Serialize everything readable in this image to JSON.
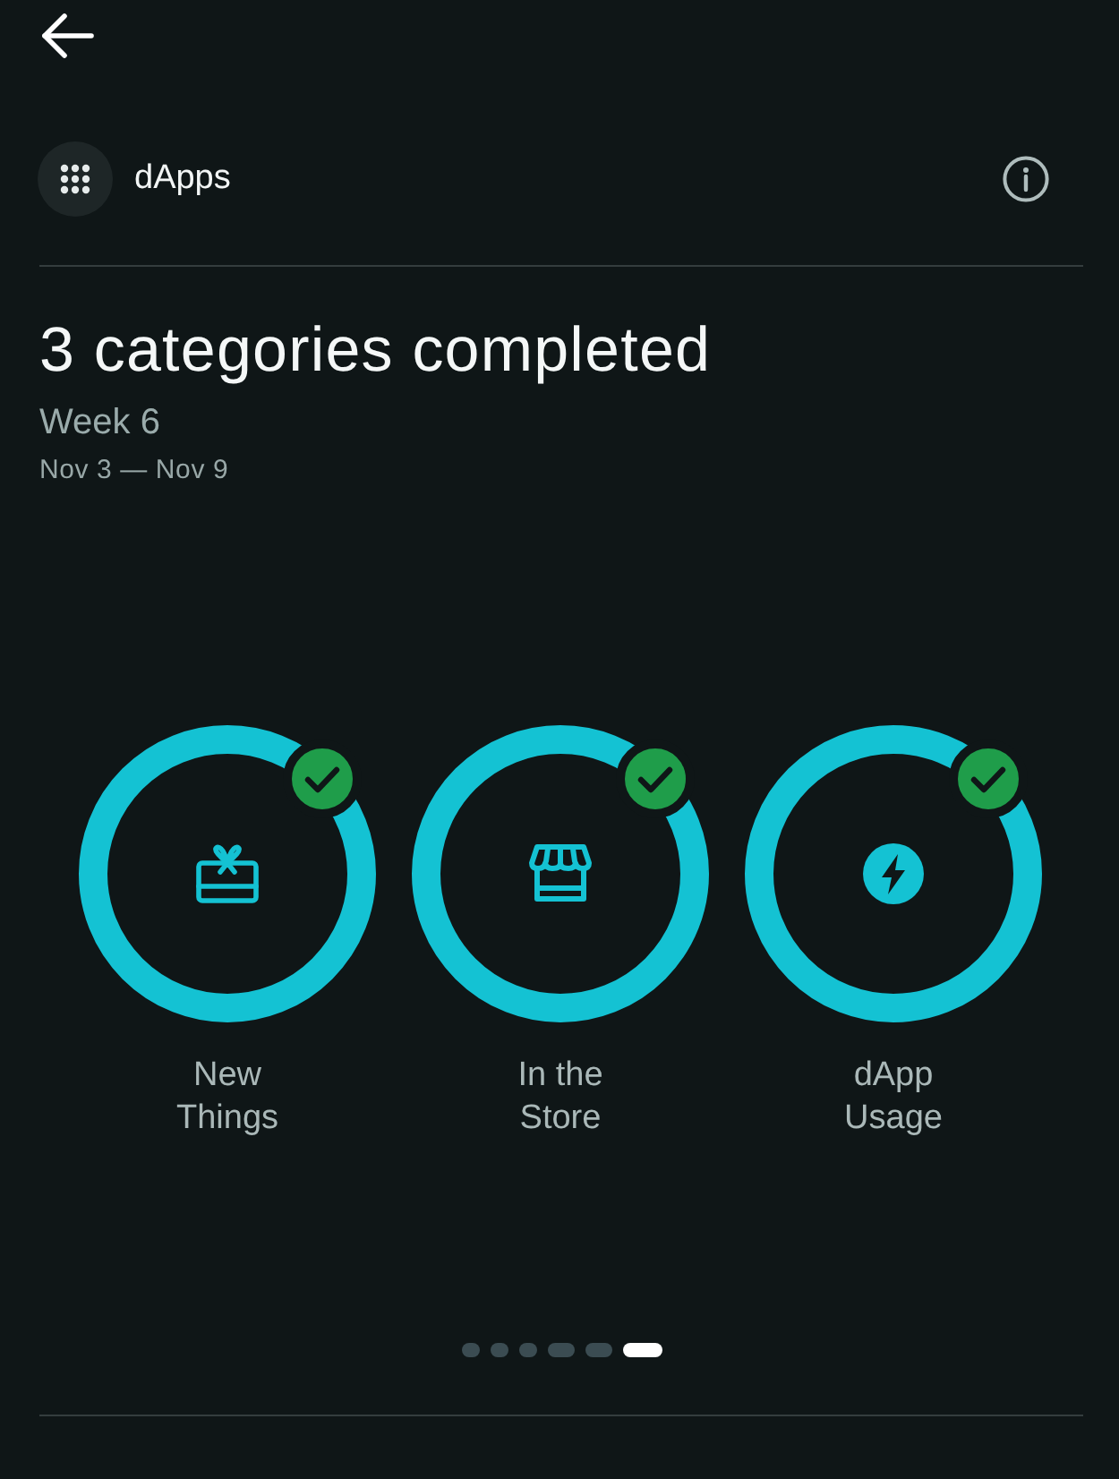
{
  "section": {
    "title": "dApps"
  },
  "summary": {
    "title": "3 categories completed",
    "week": "Week 6",
    "dates": "Nov 3 — Nov 9"
  },
  "categories": [
    {
      "kind": "gift",
      "label": "New Things",
      "completed": true
    },
    {
      "kind": "store",
      "label": "In the Store",
      "completed": true
    },
    {
      "kind": "bolt",
      "label": "dApp Usage",
      "completed": true
    }
  ],
  "pager": [
    {
      "selected": false
    },
    {
      "selected": false
    },
    {
      "selected": false
    },
    {
      "selected": false
    },
    {
      "selected": false
    },
    {
      "selected": true
    }
  ]
}
